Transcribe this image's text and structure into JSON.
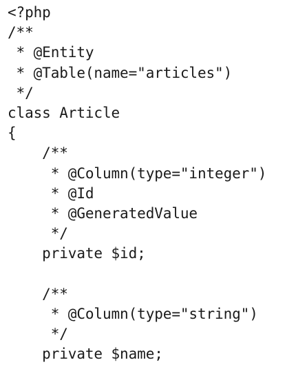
{
  "code": {
    "language": "php",
    "lines": [
      "<?php",
      "/**",
      " * @Entity",
      " * @Table(name=\"articles\")",
      " */",
      "class Article",
      "{",
      "    /**",
      "     * @Column(type=\"integer\")",
      "     * @Id",
      "     * @GeneratedValue",
      "     */",
      "    private $id;",
      "",
      "    /**",
      "     * @Column(type=\"string\")",
      "     */",
      "    private $name;"
    ]
  }
}
